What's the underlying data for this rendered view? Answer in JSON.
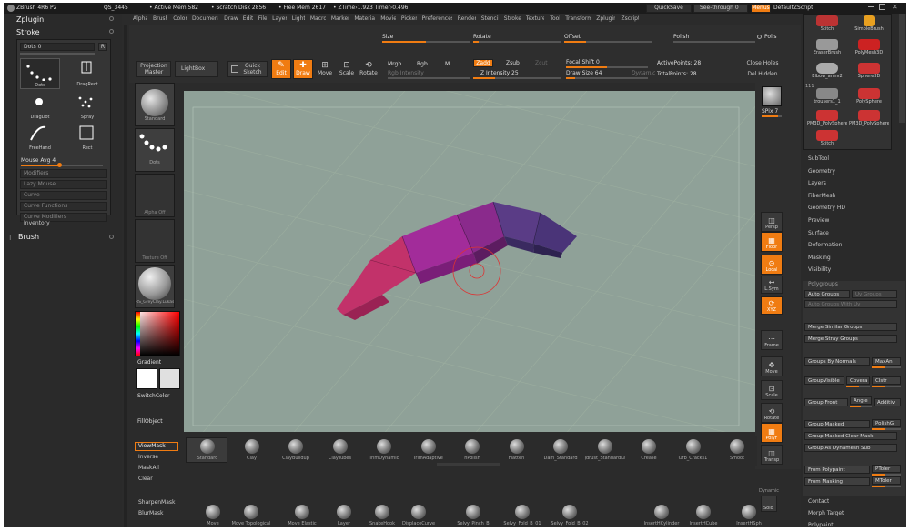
{
  "title_bar": {
    "app": "ZBrush 4R6 P2",
    "qs": "QS_3445",
    "active_mem": "• Active Mem 582",
    "scratch": "• Scratch Disk 2856",
    "free_mem": "• Free Mem 2617",
    "ztime": "• ZTime›1.923 Timer›0.496"
  },
  "menubar": [
    "Alpha",
    "Brush",
    "Color",
    "Document",
    "Draw",
    "Edit",
    "File",
    "Layer",
    "Light",
    "Macro",
    "Marker",
    "Material",
    "Movie",
    "Picker",
    "Preferences",
    "Render",
    "Stencil",
    "Stroke",
    "Texture",
    "Tool",
    "Transform",
    "Zplugin",
    "Zscript"
  ],
  "top_right": {
    "quicksave": "QuickSave",
    "seethrough": "See-through",
    "seethrough_val": "0",
    "menus": "Menus",
    "script": "DefaultZScript"
  },
  "left_panel": {
    "zplugin": "Zplugin",
    "stroke": "Stroke",
    "dots_slider": "Dots 0",
    "dots_r": "R",
    "stroke_types": [
      {
        "label": "Dots"
      },
      {
        "label": "DragRect"
      },
      {
        "label": "DragDot"
      },
      {
        "label": "Spray"
      },
      {
        "label": "FreeHand"
      },
      {
        "label": "Rect"
      }
    ],
    "mouse_avg": "Mouse Avg 4",
    "sections": [
      "Modifiers",
      "Lazy Mouse",
      "Curve",
      "Curve Functions",
      "Curve Modifiers"
    ],
    "inventory": "Inventory",
    "brush": "Brush"
  },
  "toolbar": {
    "size": "Size",
    "rotate": "Rotate",
    "offset": "Offset",
    "polish": "Polish",
    "polish_r": "Polis",
    "projection": "Projection Master",
    "lightbox": "LightBox",
    "quick_sketch": "Quick Sketch",
    "edit": "Edit",
    "draw": "Draw",
    "move": "Move",
    "scale": "Scale",
    "rotate_btn": "Rotate",
    "mrgb": "Mrgb",
    "rgb": "Rgb",
    "m": "M",
    "rgb_intensity": "Rgb Intensity",
    "zadd": "Zadd",
    "zsub": "Zsub",
    "zcut": "Zcut",
    "z_intensity": "Z Intensity 25",
    "focal_shift": "Focal Shift 0",
    "draw_size": "Draw Size 64",
    "dynamic": "Dynamic",
    "active_points": "ActivePoints: 28",
    "total_points": "TotalPoints: 28",
    "close_holes": "Close Holes",
    "del_hidden": "Del Hidden"
  },
  "left_shelf": {
    "standard": "Standard",
    "dots": "Dots",
    "alpha_off": "Alpha Off",
    "texture_off": "Texture Off",
    "material": "RS_GreyClay.Lukash",
    "gradient": "Gradient",
    "switch_color": "SwitchColor",
    "fill_object": "FillObject",
    "mask_buttons": [
      "ViewMask",
      "Inverse",
      "MaskAll",
      "Clear"
    ],
    "mask_bottom": [
      "SharpenMask",
      "BlurMask"
    ]
  },
  "right_tools": {
    "spix": "SPix 7",
    "items": [
      {
        "label": "Persp"
      },
      {
        "label": "Floor"
      },
      {
        "label": "Local"
      },
      {
        "label": "L.Sym"
      },
      {
        "label": "XYZ"
      },
      {
        "label": "Frame"
      },
      {
        "label": "Move"
      },
      {
        "label": "Scale"
      },
      {
        "label": "Rotate"
      },
      {
        "label": "PolyF"
      },
      {
        "label": "Transp"
      }
    ]
  },
  "brush_shelf": [
    "Standard",
    "Clay",
    "ClayBuildup",
    "ClayTubes",
    "TrimDynamic",
    "TrimAdaptive",
    "hPolish",
    "Flatten",
    "Dam_Standard",
    "Jdrust_StandardLa",
    "Crease",
    "Orb_Cracks1",
    "Smoot"
  ],
  "bottom_shelf": [
    "Move",
    "Move Topological",
    "Move Elastic",
    "Layer",
    "SnakeHook",
    "DisplaceCurve",
    "Selvy_Pinch_B",
    "Selvy_Fold_B_01",
    "Selvy_Fold_B_02",
    "InsertHCylinder",
    "InsertHCube",
    "InsertHSph"
  ],
  "dynamic_label": "Dynamic",
  "solo_label": "Solo",
  "right_panel": {
    "thumbs": [
      {
        "label": "Stitch"
      },
      {
        "label": "SimpleBrush"
      },
      {
        "label": "EraserBrush"
      },
      {
        "label": "PolyMesh3D"
      },
      {
        "label": "Elbow_armv2"
      },
      {
        "label": "Sphere3D"
      },
      {
        "label": "trousers1_1"
      },
      {
        "label": "PolySphere"
      },
      {
        "label": "PM3D_PolySphere"
      },
      {
        "label": "PM3D_PolySphere_2"
      },
      {
        "label": "Stitch"
      }
    ],
    "count_label": "111",
    "sections": [
      "SubTool",
      "Geometry",
      "Layers",
      "FiberMesh",
      "Geometry HD",
      "Preview",
      "Surface",
      "Deformation",
      "Masking",
      "Visibility"
    ],
    "polygroups": "Polygroups",
    "auto_groups": "Auto Groups",
    "uv_groups": "Uv Groups",
    "auto_groups_uv": "Auto Groups With Uv",
    "merge_similar": "Merge Similar Groups",
    "merge_stray": "Merge Stray Groups",
    "groups_by_normals": "Groups By Normals",
    "maxang": "MaxAn",
    "group_visible": "GroupVisible",
    "coverage": "Covera",
    "clustersize": "Clstr",
    "group_front": "Group Front",
    "angle": "Angle",
    "additive": "Additiv",
    "group_masked": "Group Masked",
    "polish_g": "PolishG",
    "group_masked_clear": "Group Masked Clear Mask",
    "group_dynamesh": "Group As Dynamesh Sub",
    "from_polypaint": "From Polypaint",
    "ptoler": "PToler",
    "from_masking": "From Masking",
    "mtoler": "MToler",
    "bottom": [
      "Contact",
      "Morph Target",
      "Polypaint"
    ]
  },
  "colors": {
    "accent": "#f07c12",
    "canvas": "#8fa198",
    "magenta": "#c2326a",
    "purple": "#8c2a8c",
    "violet": "#5a3c86"
  }
}
